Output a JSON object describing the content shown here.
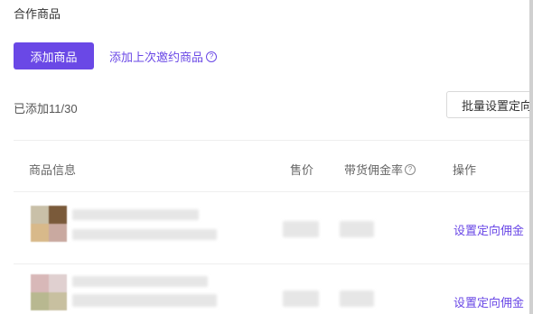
{
  "section": {
    "title": "合作商品"
  },
  "toolbar": {
    "add_button_label": "添加商品",
    "add_last_label": "添加上次邀约商品",
    "help_glyph": "?"
  },
  "summary": {
    "added_text": "已添加11/30",
    "batch_button_label": "批量设置定向"
  },
  "table": {
    "headers": {
      "info": "商品信息",
      "price": "售价",
      "rate": "带货佣金率",
      "action": "操作"
    },
    "rows": [
      {
        "action_label": "设置定向佣金"
      },
      {
        "action_label": "设置定向佣金"
      }
    ]
  },
  "colors": {
    "accent": "#6a48e6",
    "divider": "#eeeeee",
    "placeholder": "#e6e6e6"
  }
}
